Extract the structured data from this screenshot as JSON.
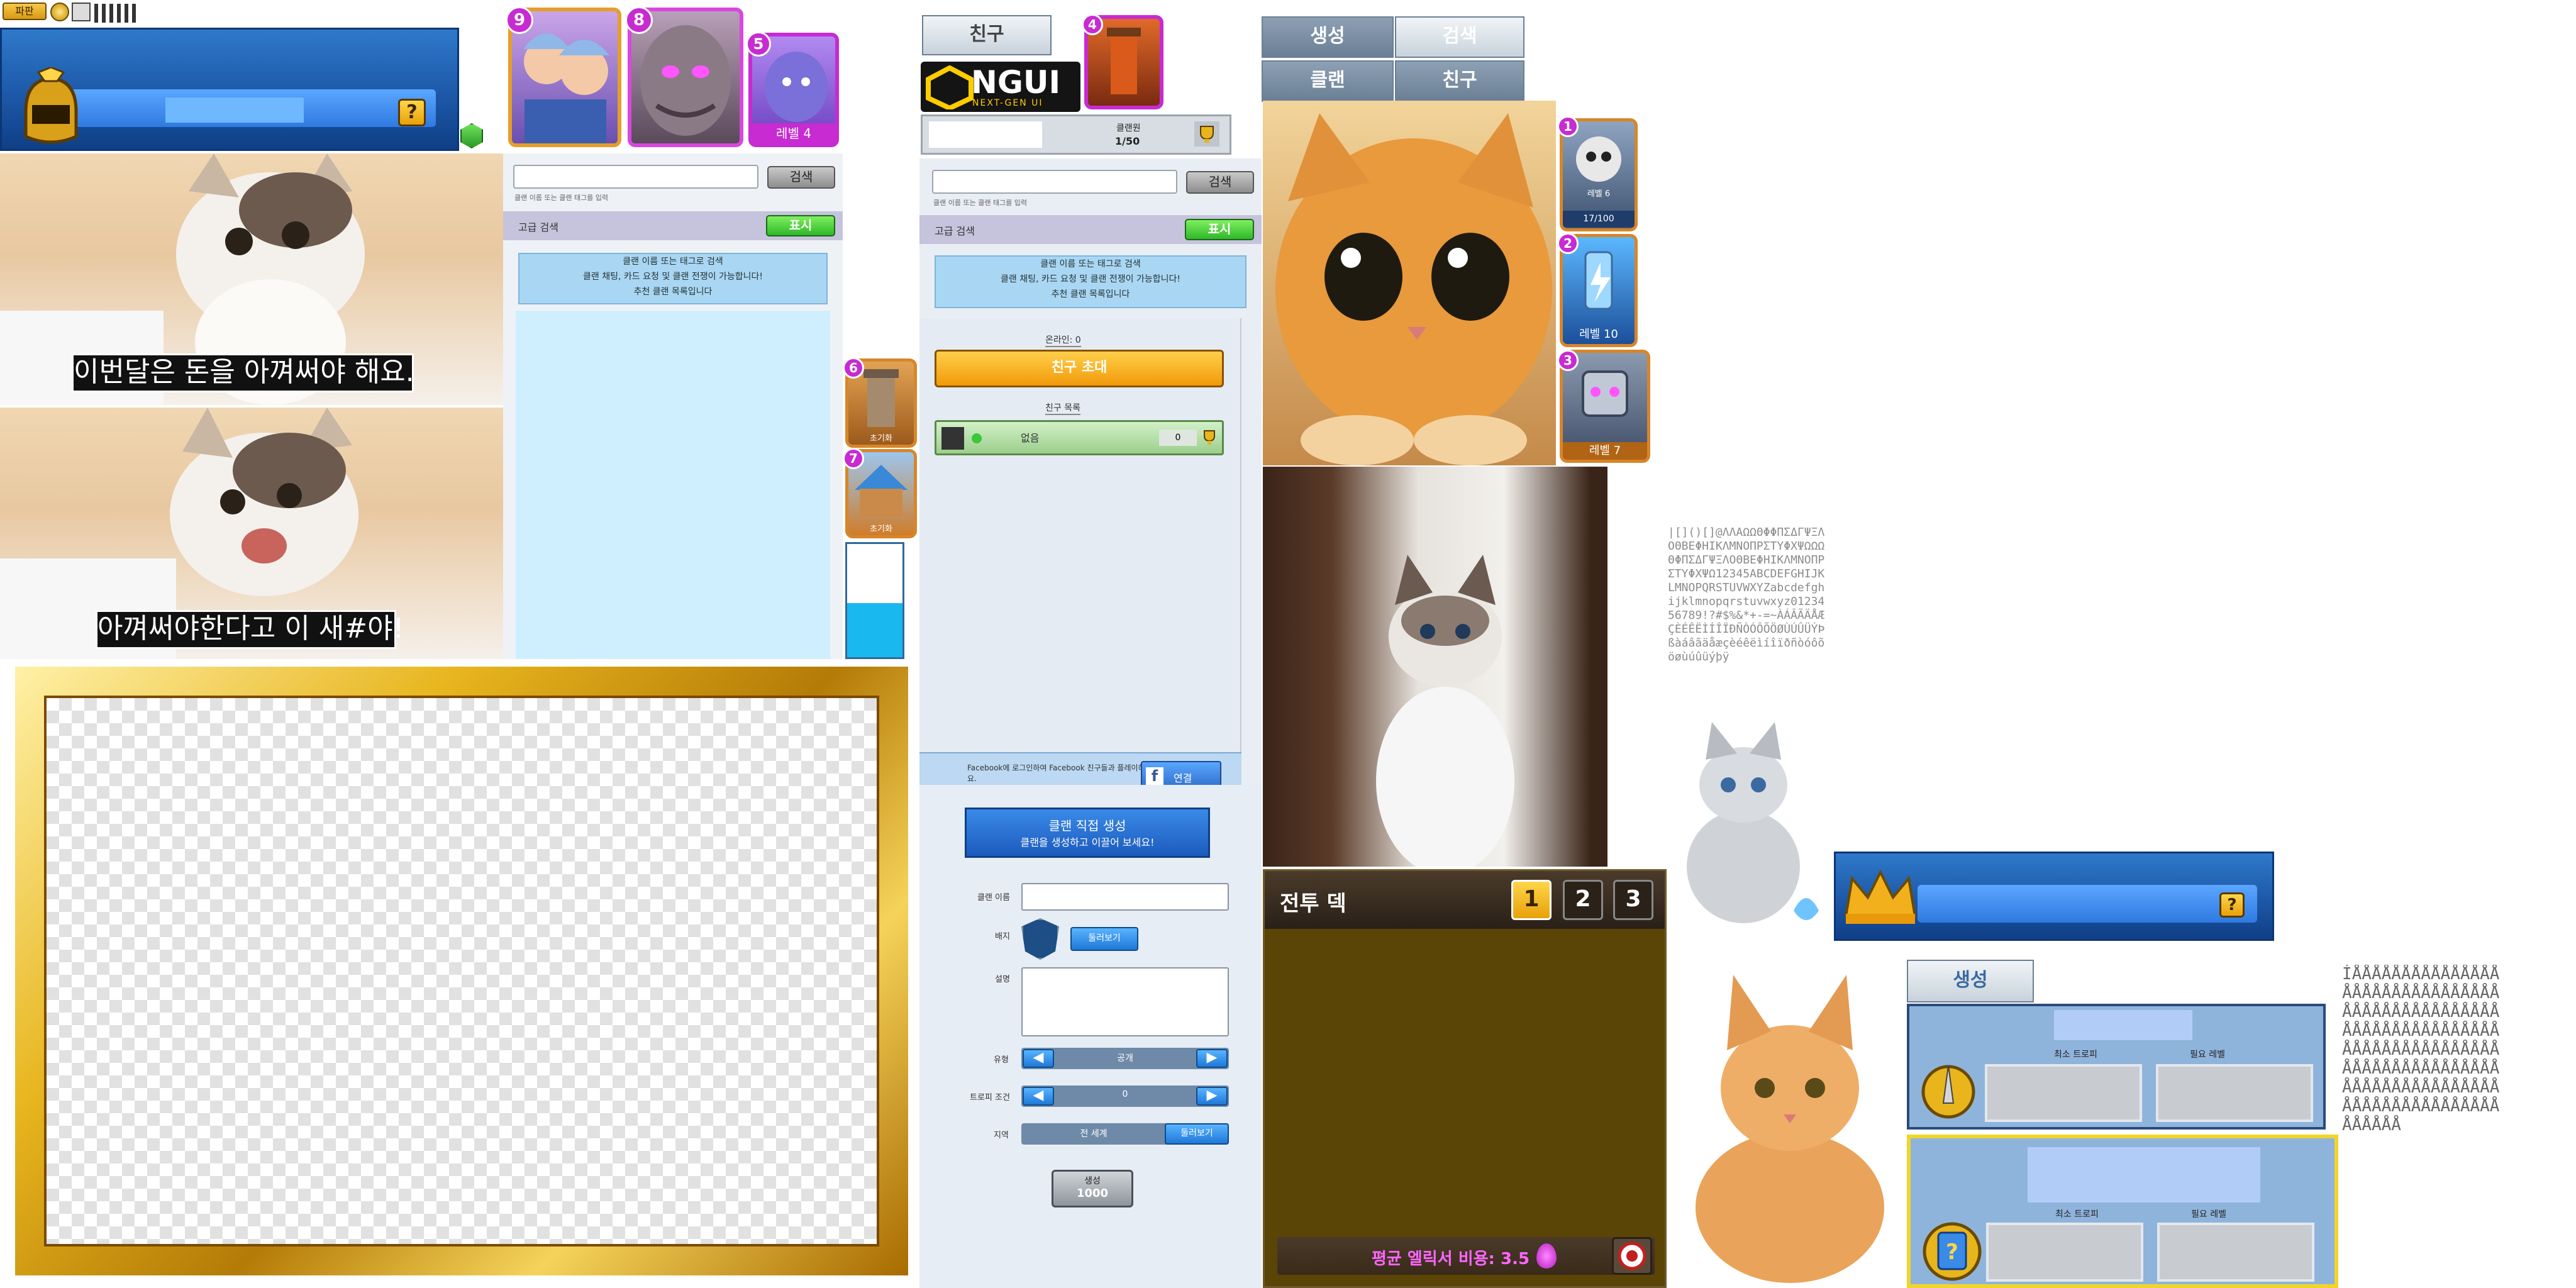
{
  "atlas_top_strip": {
    "tiny_button_label": "파판"
  },
  "king_banner": {
    "question": "?"
  },
  "top_cards": [
    {
      "badge": "9"
    },
    {
      "badge": "8"
    },
    {
      "badge": "5",
      "level": "레벨 4"
    }
  ],
  "meme": {
    "caption_top": "이번달은 돈을 아껴써야 해요.",
    "caption_bottom": "아껴써야한다고 이 새#야!"
  },
  "clan_search_panel": {
    "search_hint": "클랜 이름 또는 클랜 태그를 입력",
    "search_button": "검색",
    "filter_label": "고급 검색",
    "filter_button": "표시",
    "info_line1": "클랜 이름 또는 태그로 검색",
    "info_line2": "클랜 채팅, 카드 요청 및 클랜 전쟁이 가능합니다!",
    "info_line3": "추천 클랜 목록입니다"
  },
  "side_cards": [
    {
      "badge": "6",
      "label": "초기화"
    },
    {
      "badge": "7",
      "label": "초기화"
    }
  ],
  "friend_panel": {
    "tab": "친구",
    "logo_main": "NGUI",
    "logo_sub": "NEXT-GEN UI",
    "card_badge": "4",
    "clan_label": "클랜원",
    "clan_count": "1/50",
    "search_hint": "클랜 이름 또는 클랜 태그를 입력",
    "search_button": "검색",
    "filter_label": "고급 검색",
    "filter_button": "표시",
    "info_line1": "클랜 이름 또는 태그로 검색",
    "info_line2": "클랜 채팅, 카드 요청 및 클랜 전쟁이 가능합니다!",
    "info_line3": "추천 클랜 목록입니다",
    "friends_count_label": "온라인: 0",
    "invite_button": "친구 초대",
    "friends_list_label": "친구 목록",
    "friend_row_name": "없음",
    "friend_row_trophies": "0",
    "facebook_text": "Facebook에 로그인하여 Facebook 친구들과 플레이하세요.",
    "facebook_button": "연결"
  },
  "clan_create": {
    "ribbon_line1": "클랜 직접 생성",
    "ribbon_line2": "클랜을 생성하고 이끌어 보세요!",
    "name_label": "클랜 이름",
    "badge_label": "배지",
    "badge_button": "둘러보기",
    "desc_label": "설명",
    "type_label": "유형",
    "type_value": "공개",
    "trophy_label": "트로피 조건",
    "trophy_value": "0",
    "region_label": "지역",
    "region_value": "전 세계",
    "region_button": "둘러보기",
    "create_label": "생성",
    "create_cost": "1000"
  },
  "tabs_panel": {
    "tab1": "생성",
    "tab2": "검색",
    "tab3": "클랜",
    "tab4": "친구"
  },
  "right_cards": [
    {
      "badge": "1",
      "count": "17/100",
      "level": "레벨 6"
    },
    {
      "badge": "2",
      "level": "레벨 10"
    },
    {
      "badge": "3",
      "level": "레벨 7"
    }
  ],
  "deck": {
    "title": "전투 덱",
    "tabs": [
      "1",
      "2",
      "3"
    ],
    "elixir_label": "평균 엘릭서 비용: 3.5"
  },
  "small_banner": {
    "question": "?"
  },
  "create_panel": {
    "tab": "생성",
    "col1": "최소 트로피",
    "col2": "필요 레벨"
  },
  "font_atlas_1": "|[]()[]@ΛΛΑΩΩΘΦΦΠΣΔΓΨΞΛΟΘΒΕΦΗΙΚΛΜΝΟΠΡΣΤΥΦΧΨΩΩΩΘΦΠΣΔΓΨΞΛΟΘΒΕΦΗΙΚΛΜΝΟΠΡΣΤΥΦΧΨΩ12345ABCDEFGHIJKLMNOPQRSTUVWXYZabcdefghijklmnopqrstuvwxyz0123456789!?#$%&*+-=~ÀÁÂÃÄÅÆÇÈÉÊËÌÍÎÏÐÑÒÓÔÕÖØÙÚÛÜÝÞßàáâãäåæçèéêëìíîïðñòóôõöøùúûüýþÿ",
  "font_atlas_2": "ÍÅÅÅÅÅÅÅÅÅÅÅÅÅÅÅÅÅÅÅÅÅÅÅÅÅÅÅÅÅÅÅÅÅÅÅÅÅÅÅÅÅÅÅÅÅÅÅÅÅÅÅÅÅÅÅÅÅÅÅÅÅÅÅÅÅÅÅÅÅÅÅÅÅÅÅÅÅÅÅÅÅÅÅÅÅÅÅÅÅÅÅÅÅÅÅÅÅÅÅÅÅÅÅÅÅÅÅÅÅÅÅÅÅÅÅÅÅÅÅÅÅÅÅÅÅÅÅÅÅÅÅÅÅ",
  "colors": {
    "banner_blue": "#1d58a8",
    "gold": "#e8b51c",
    "purple_badge": "#c72bd1",
    "deck_brown": "#5a4406"
  }
}
